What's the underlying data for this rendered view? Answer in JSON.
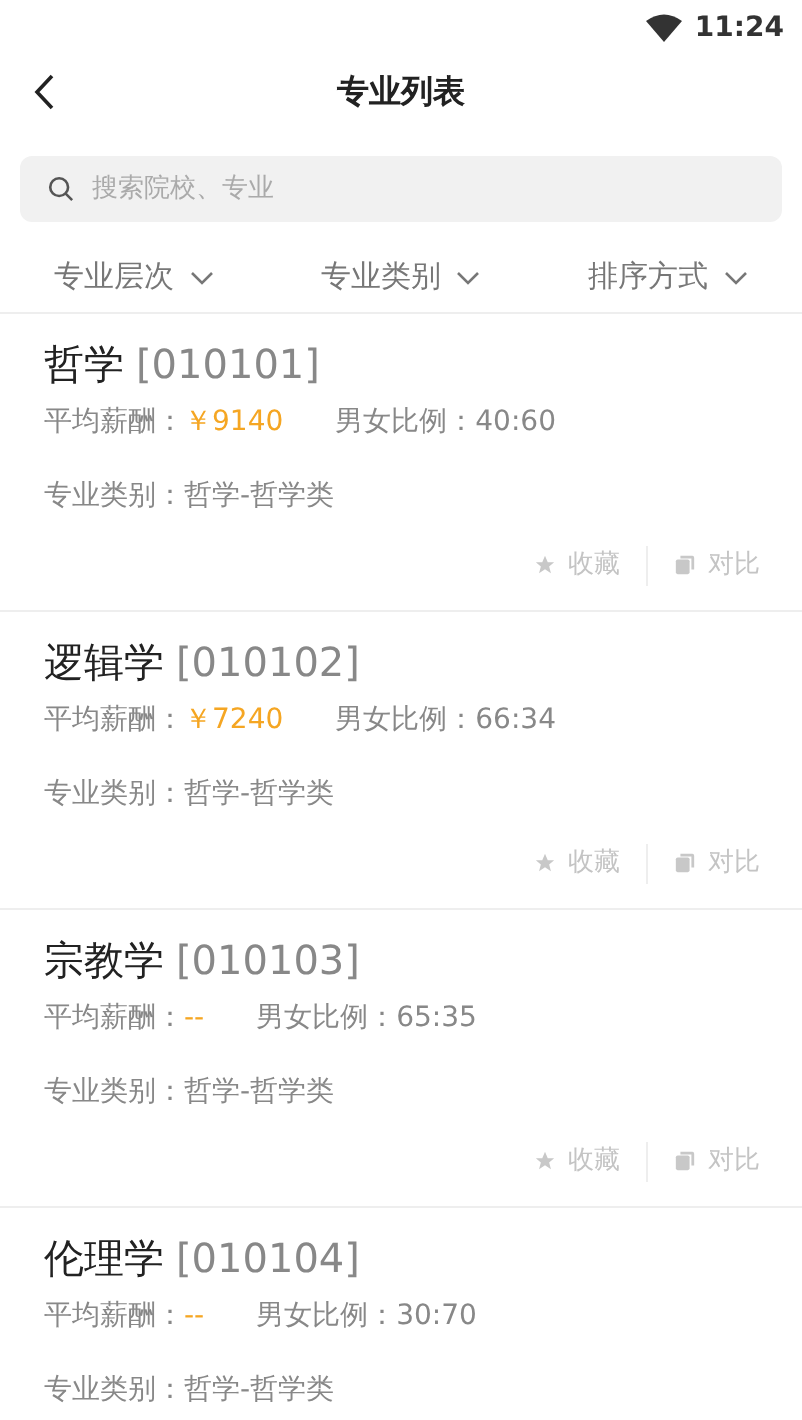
{
  "status_bar": {
    "time": "11:24"
  },
  "header": {
    "title": "专业列表"
  },
  "search": {
    "placeholder": "搜索院校、专业"
  },
  "filters": [
    {
      "label": "专业层次"
    },
    {
      "label": "专业类别"
    },
    {
      "label": "排序方式"
    }
  ],
  "majors": [
    {
      "name": "哲学",
      "code": "[010101]",
      "salary_label": "平均薪酬：",
      "salary": "￥9140",
      "ratio": "男女比例：40:60",
      "category": "专业类别：哲学-哲学类",
      "actions": [
        {
          "kind": "star",
          "label": "收藏"
        },
        {
          "kind": "compare",
          "label": "对比"
        }
      ]
    },
    {
      "name": "逻辑学",
      "code": "[010102]",
      "salary_label": "平均薪酬：",
      "salary": "￥7240",
      "ratio": "男女比例：66:34",
      "category": "专业类别：哲学-哲学类",
      "actions": [
        {
          "kind": "star",
          "label": "收藏"
        },
        {
          "kind": "compare",
          "label": "对比"
        }
      ]
    },
    {
      "name": "宗教学",
      "code": "[010103]",
      "salary_label": "平均薪酬：",
      "salary": "--",
      "ratio": "男女比例：65:35",
      "category": "专业类别：哲学-哲学类",
      "actions": [
        {
          "kind": "star",
          "label": "收藏"
        },
        {
          "kind": "compare",
          "label": "对比"
        }
      ]
    },
    {
      "name": "伦理学",
      "code": "[010104]",
      "salary_label": "平均薪酬：",
      "salary": "--",
      "ratio": "男女比例：30:70",
      "category": "专业类别：哲学-哲学类"
    }
  ]
}
